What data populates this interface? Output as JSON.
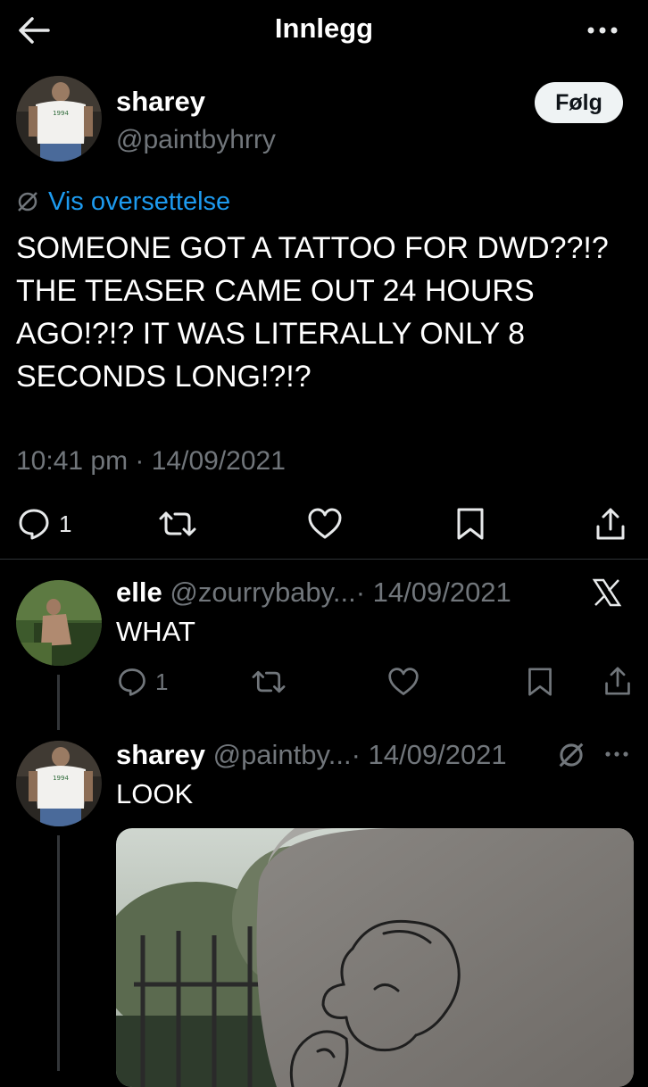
{
  "header": {
    "title": "Innlegg",
    "back_icon": "arrow-left-icon",
    "more_icon": "more-horizontal-icon"
  },
  "main_post": {
    "display_name": "sharey",
    "handle": "@paintbyhrry",
    "follow_label": "Følg",
    "translate_label": "Vis oversettelse",
    "text_lines": [
      "SOMEONE GOT A TATTOO FOR DWD??!?",
      "THE TEASER CAME OUT 24 HOURS",
      "AGO!?!? IT WAS LITERALLY ONLY 8",
      "SECONDS LONG!?!?"
    ],
    "timestamp": "10:41 pm · 14/09/2021",
    "reply_count": "1"
  },
  "replies": [
    {
      "display_name": "elle",
      "handle": "@zourrybaby...",
      "date": "· 14/09/2021",
      "text": "WHAT",
      "reply_count": "1",
      "badge_icon": "x-logo-icon"
    },
    {
      "display_name": "sharey",
      "handle": "@paintby...",
      "date": "· 14/09/2021",
      "text": "LOOK",
      "badge_icon": "translate-icon",
      "more_icon": "more-horizontal-icon"
    }
  ],
  "colors": {
    "background": "#000000",
    "text": "#ffffff",
    "secondary": "#71767b",
    "link": "#1d9bf0",
    "divider": "#2f3336",
    "follow_bg": "#eff3f4"
  }
}
